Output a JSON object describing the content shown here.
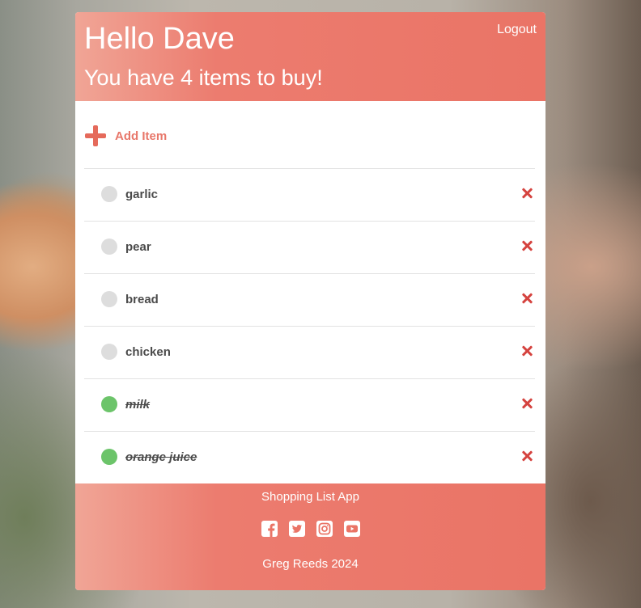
{
  "header": {
    "greeting": "Hello Dave",
    "summary": "You have 4 items to buy!",
    "logout_label": "Logout"
  },
  "add_item": {
    "label": "Add Item",
    "icon": "plus-icon"
  },
  "items": [
    {
      "name": "garlic",
      "done": false
    },
    {
      "name": "pear",
      "done": false
    },
    {
      "name": "bread",
      "done": false
    },
    {
      "name": "chicken",
      "done": false
    },
    {
      "name": "milk",
      "done": true
    },
    {
      "name": "orange juice",
      "done": true
    }
  ],
  "footer": {
    "app_name": "Shopping List App",
    "socials": [
      "facebook-icon",
      "twitter-icon",
      "instagram-icon",
      "youtube-icon"
    ],
    "copyright": "Greg Reeds 2024"
  },
  "colors": {
    "accent": "#ea7466",
    "done": "#6cc46a",
    "pending": "#dddddd",
    "delete": "#d5433f"
  }
}
